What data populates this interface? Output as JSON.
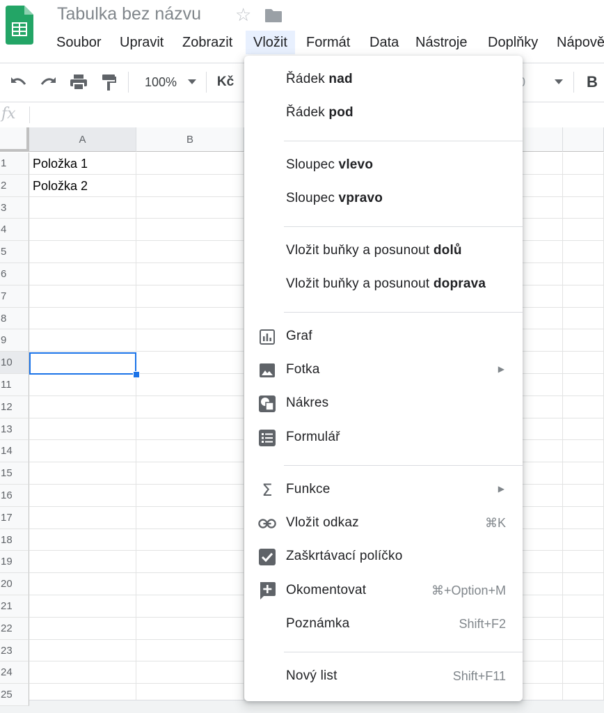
{
  "header": {
    "doc_title": "Tabulka bez názvu",
    "brand_color": "#188038"
  },
  "menubar": {
    "items": [
      "Soubor",
      "Upravit",
      "Zobrazit",
      "Vložit",
      "Formát",
      "Data",
      "Nástroje",
      "Doplňky",
      "Nápově"
    ],
    "active": "Vložit"
  },
  "toolbar": {
    "zoom": "100%",
    "currency": "Kč",
    "bold": "B",
    "font_size_fragment": "0"
  },
  "formula_bar": {
    "fx_label": "fx"
  },
  "grid": {
    "columns": [
      "A",
      "B"
    ],
    "rows": [
      "1",
      "2",
      "3",
      "4",
      "5",
      "6",
      "7",
      "8",
      "9",
      "10",
      "11",
      "12",
      "13",
      "14",
      "15",
      "16",
      "17",
      "18",
      "19",
      "20",
      "21",
      "22",
      "23",
      "24",
      "25"
    ],
    "cells": {
      "A1": "Položka 1",
      "A2": "Položka 2"
    },
    "active_cell": "A10",
    "accent_color": "#1a73e8"
  },
  "insert_menu": {
    "row_above": {
      "prefix": "Řádek ",
      "bold": "nad"
    },
    "row_below": {
      "prefix": "Řádek ",
      "bold": "pod"
    },
    "col_left": {
      "prefix": "Sloupec ",
      "bold": "vlevo"
    },
    "col_right": {
      "prefix": "Sloupec ",
      "bold": "vpravo"
    },
    "cells_down": {
      "prefix": "Vložit buňky a posunout ",
      "bold": "dolů"
    },
    "cells_right": {
      "prefix": "Vložit buňky a posunout ",
      "bold": "doprava"
    },
    "chart": {
      "label": "Graf",
      "icon": "chart-icon"
    },
    "image": {
      "label": "Fotka",
      "icon": "image-icon",
      "submenu": true
    },
    "drawing": {
      "label": "Nákres",
      "icon": "drawing-icon"
    },
    "form": {
      "label": "Formulář",
      "icon": "form-icon"
    },
    "function": {
      "label": "Funkce",
      "icon": "sigma-icon",
      "submenu": true
    },
    "link": {
      "label": "Vložit odkaz",
      "icon": "link-icon",
      "shortcut": "⌘K"
    },
    "checkbox": {
      "label": "Zaškrtávací políčko",
      "icon": "checkbox-icon"
    },
    "comment": {
      "label": "Okomentovat",
      "icon": "add-comment-icon",
      "shortcut": "⌘+Option+M"
    },
    "note": {
      "label": "Poznámka",
      "shortcut": "Shift+F2"
    },
    "new_sheet": {
      "label": "Nový list",
      "shortcut": "Shift+F11"
    }
  }
}
